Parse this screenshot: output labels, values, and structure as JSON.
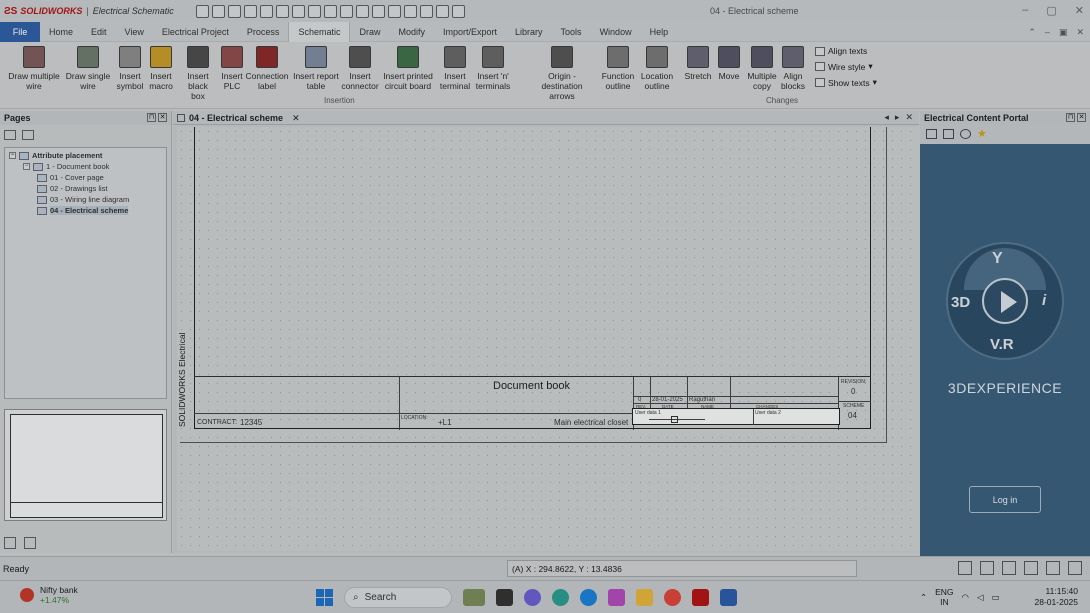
{
  "titlebar": {
    "brand": "SOLIDWORKS",
    "product": "Electrical Schematic",
    "document_title": "04 - Electrical scheme"
  },
  "menu": {
    "file": "File",
    "items": [
      "Home",
      "Edit",
      "View",
      "Electrical Project",
      "Process",
      "Schematic",
      "Draw",
      "Modify",
      "Import/Export",
      "Library",
      "Tools",
      "Window",
      "Help"
    ],
    "active": "Schematic"
  },
  "ribbon": {
    "buttons": [
      {
        "label": "Draw multiple wire"
      },
      {
        "label": "Draw single wire"
      },
      {
        "label": "Insert symbol"
      },
      {
        "label": "Insert macro"
      },
      {
        "label": "Insert black box"
      },
      {
        "label": "Insert PLC"
      },
      {
        "label": "Connection label"
      },
      {
        "label": "Insert report table"
      },
      {
        "label": "Insert connector"
      },
      {
        "label": "Insert printed circuit board"
      },
      {
        "label": "Insert terminal"
      },
      {
        "label": "Insert 'n' terminals"
      },
      {
        "label": "Origin - destination arrows"
      },
      {
        "label": "Function outline"
      },
      {
        "label": "Location outline"
      },
      {
        "label": "Stretch"
      },
      {
        "label": "Move"
      },
      {
        "label": "Multiple copy"
      },
      {
        "label": "Align blocks"
      }
    ],
    "group_insertion": "Insertion",
    "group_changes": "Changes",
    "small": [
      "Align texts",
      "Wire style",
      "Show texts"
    ]
  },
  "pages": {
    "title": "Pages",
    "tree": [
      {
        "label": "Attribute placement",
        "level": 0
      },
      {
        "label": "1 - Document book",
        "level": 1
      },
      {
        "label": "01 - Cover page",
        "level": 2
      },
      {
        "label": "02 - Drawings list",
        "level": 2
      },
      {
        "label": "03 - Wiring line diagram",
        "level": 2
      },
      {
        "label": "04 - Electrical scheme",
        "level": 2
      }
    ]
  },
  "document": {
    "tab_label": "04 - Electrical scheme",
    "side_label": "SOLIDWORKS Electrical",
    "title_block": {
      "title": "Document book",
      "contract_label": "CONTRACT:",
      "contract_value": "12345",
      "location_label": "LOCATION:",
      "location_value": "+L1",
      "location_desc": "Main electrical closet",
      "revision_label": "REVISION:",
      "revision_value": "0",
      "scheme_label": "SCHEME",
      "scheme_value": "04",
      "rev_row": {
        "rev": "0",
        "date": "28-01-2025",
        "name": "Raguthan"
      },
      "headers": {
        "rev": "REV.",
        "date": "DATE",
        "name": "NAME",
        "changes": "CHANGES"
      },
      "user_data_1": "User data 1",
      "user_data_2": "User data 2"
    }
  },
  "portal": {
    "title": "Electrical Content Portal",
    "brand": "3DEXPERIENCE",
    "label_3d": "3D",
    "label_vr": "V.R",
    "label_i": "i",
    "login": "Log in"
  },
  "status": {
    "ready": "Ready",
    "coords": "(A) X : 294.8622, Y : 13.4836"
  },
  "taskbar": {
    "weather_title": "Nifty bank",
    "weather_change": "+1.47%",
    "search": "Search",
    "lang1": "ENG",
    "lang2": "IN",
    "time": "11:15:40",
    "date": "28-01-2025"
  }
}
